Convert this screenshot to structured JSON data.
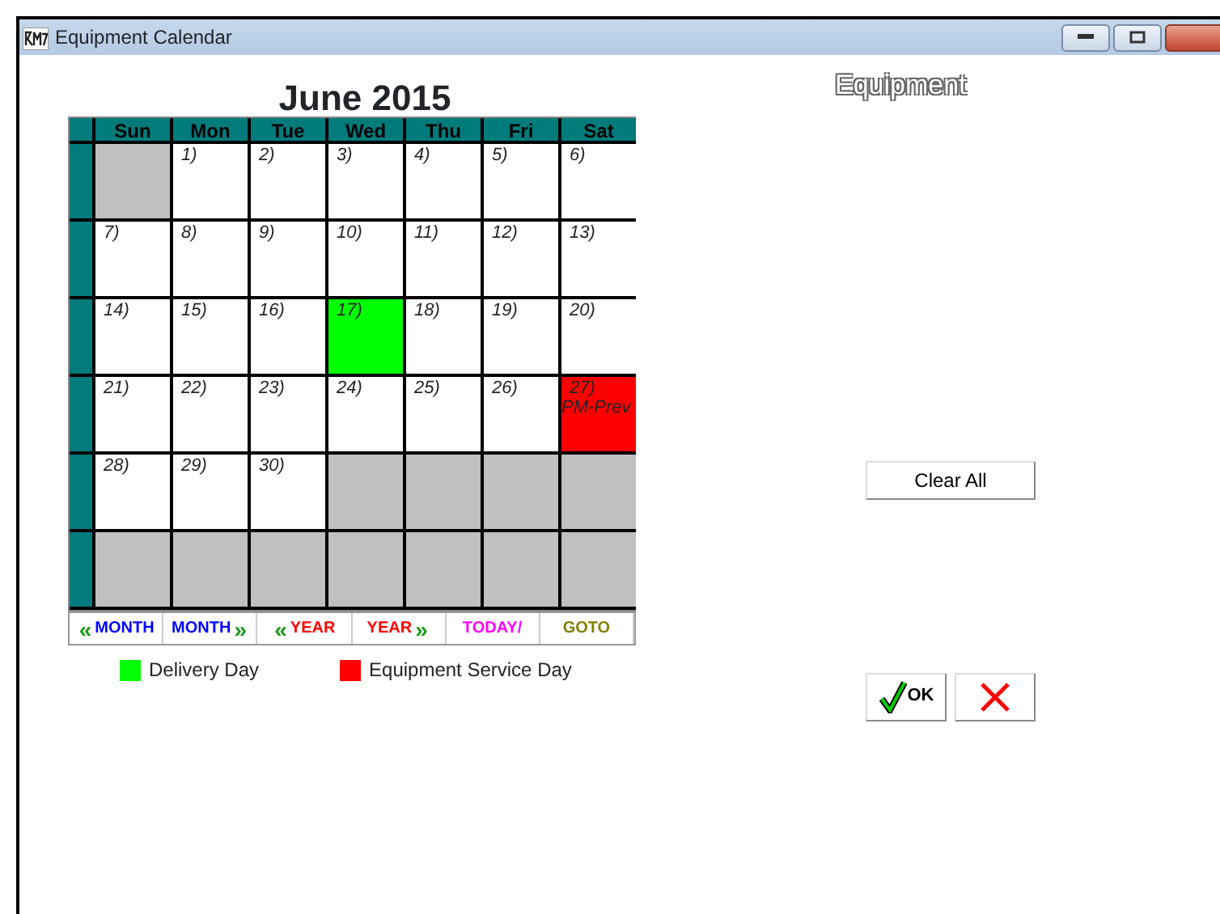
{
  "window": {
    "title": "Equipment Calendar"
  },
  "heading": "Equipment",
  "calendar": {
    "title": "June 2015",
    "weekdays": [
      "Sun",
      "Mon",
      "Tue",
      "Wed",
      "Thu",
      "Fri",
      "Sat"
    ],
    "weeks": [
      [
        {
          "kind": "blank"
        },
        {
          "kind": "day",
          "label": "1)"
        },
        {
          "kind": "day",
          "label": "2)"
        },
        {
          "kind": "day",
          "label": "3)"
        },
        {
          "kind": "day",
          "label": "4)"
        },
        {
          "kind": "day",
          "label": "5)"
        },
        {
          "kind": "day",
          "label": "6)"
        }
      ],
      [
        {
          "kind": "day",
          "label": "7)"
        },
        {
          "kind": "day",
          "label": "8)"
        },
        {
          "kind": "day",
          "label": "9)"
        },
        {
          "kind": "day",
          "label": "10)"
        },
        {
          "kind": "day",
          "label": "11)"
        },
        {
          "kind": "day",
          "label": "12)"
        },
        {
          "kind": "day",
          "label": "13)"
        }
      ],
      [
        {
          "kind": "day",
          "label": "14)"
        },
        {
          "kind": "day",
          "label": "15)"
        },
        {
          "kind": "day",
          "label": "16)"
        },
        {
          "kind": "day",
          "label": "17)",
          "color": "#00ff00"
        },
        {
          "kind": "day",
          "label": "18)"
        },
        {
          "kind": "day",
          "label": "19)"
        },
        {
          "kind": "day",
          "label": "20)"
        }
      ],
      [
        {
          "kind": "day",
          "label": "21)"
        },
        {
          "kind": "day",
          "label": "22)"
        },
        {
          "kind": "day",
          "label": "23)"
        },
        {
          "kind": "day",
          "label": "24)"
        },
        {
          "kind": "day",
          "label": "25)"
        },
        {
          "kind": "day",
          "label": "26)"
        },
        {
          "kind": "day",
          "label": "27)",
          "color": "#ff0000",
          "note": "PM-Prev"
        }
      ],
      [
        {
          "kind": "day",
          "label": "28)"
        },
        {
          "kind": "day",
          "label": "29)"
        },
        {
          "kind": "day",
          "label": "30)"
        },
        {
          "kind": "blank"
        },
        {
          "kind": "blank"
        },
        {
          "kind": "blank"
        },
        {
          "kind": "blank"
        }
      ],
      [
        {
          "kind": "blank"
        },
        {
          "kind": "blank"
        },
        {
          "kind": "blank"
        },
        {
          "kind": "blank"
        },
        {
          "kind": "blank"
        },
        {
          "kind": "blank"
        },
        {
          "kind": "blank"
        }
      ]
    ],
    "nav": [
      {
        "label": "MONTH",
        "arrow_before": "«",
        "color": "#0000ff"
      },
      {
        "label": "MONTH",
        "arrow_after": "»",
        "color": "#0000ff"
      },
      {
        "label": "YEAR",
        "arrow_before": "«",
        "color": "#ff0000"
      },
      {
        "label": "YEAR",
        "arrow_after": "»",
        "color": "#ff0000"
      },
      {
        "label": "TODAY/",
        "color": "#ff00ff"
      },
      {
        "label": "GOTO",
        "color": "#808000"
      }
    ]
  },
  "legend": [
    {
      "label": "Delivery Day",
      "color": "#00ff00"
    },
    {
      "label": "Equipment Service Day",
      "color": "#ff0000"
    }
  ],
  "buttons": {
    "clear": "Clear All",
    "ok": "OK"
  }
}
